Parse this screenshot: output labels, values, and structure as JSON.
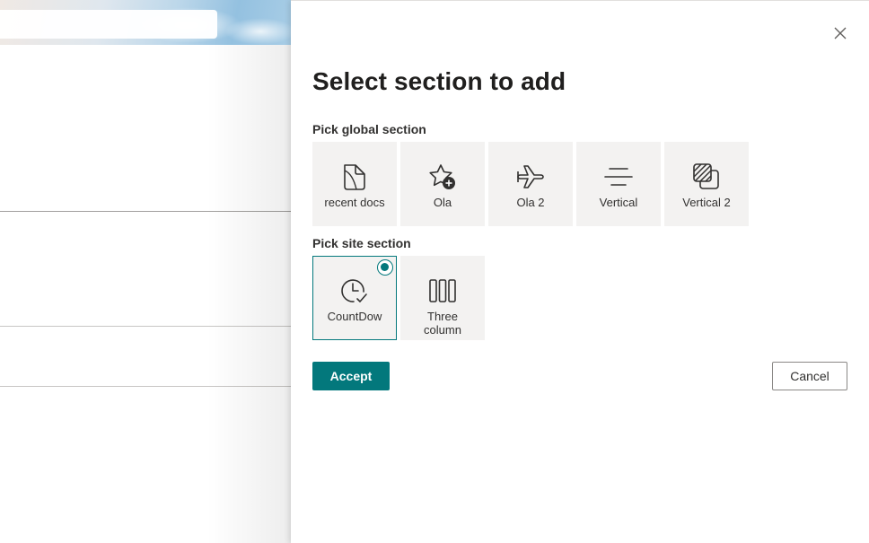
{
  "panel": {
    "title": "Select section to add",
    "close_label": "✕"
  },
  "global_section": {
    "label": "Pick global section",
    "tiles": [
      {
        "label": "recent docs",
        "icon": "document-icon"
      },
      {
        "label": "Ola",
        "icon": "star-add-icon"
      },
      {
        "label": "Ola 2",
        "icon": "airplane-icon"
      },
      {
        "label": "Vertical",
        "icon": "text-center-icon"
      },
      {
        "label": "Vertical 2",
        "icon": "hatched-squares-icon"
      }
    ]
  },
  "site_section": {
    "label": "Pick site section",
    "tiles": [
      {
        "label": "CountDow",
        "icon": "clock-check-icon",
        "selected": true
      },
      {
        "label": "Three column",
        "icon": "three-columns-icon",
        "selected": false
      }
    ]
  },
  "buttons": {
    "accept": "Accept",
    "cancel": "Cancel"
  },
  "colors": {
    "accent": "#03787c",
    "tile_bg": "#f3f2f1",
    "text": "#323130"
  }
}
